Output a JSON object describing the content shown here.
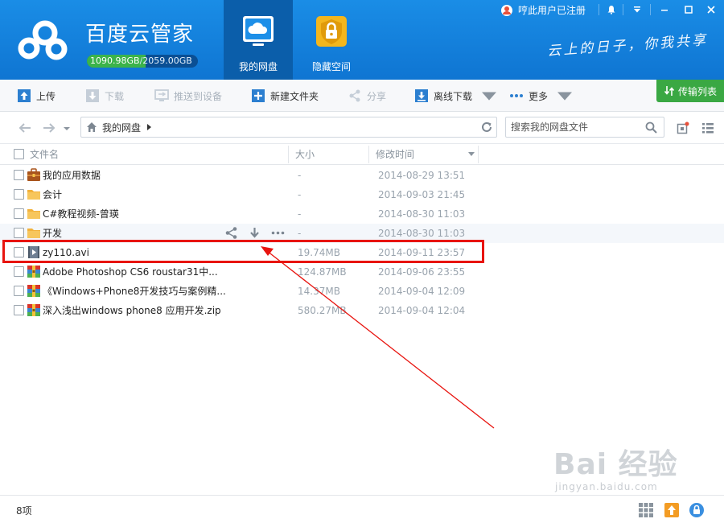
{
  "app": {
    "title": "百度云管家",
    "quota_used": "1090.98GB",
    "quota_separator": "/",
    "quota_total": "2059.00GB",
    "quota_fraction": 0.53,
    "slogan": "云上的日子，你我共享"
  },
  "nav_tabs": [
    {
      "label": "我的网盘",
      "icon": "cloud-disk-icon",
      "active": true
    },
    {
      "label": "隐藏空间",
      "icon": "lock-shield-icon",
      "active": false
    }
  ],
  "topbar": {
    "user_text": "哼此用户已注册",
    "buttons": [
      "bell-icon",
      "menu-down-icon",
      "minimize-icon",
      "maximize-icon",
      "close-icon"
    ]
  },
  "toolbar": {
    "upload": "上传",
    "download": "下载",
    "push_device": "推送到设备",
    "new_folder": "新建文件夹",
    "share": "分享",
    "offline_download": "离线下载",
    "more": "更多",
    "transfer_list": "传输列表"
  },
  "address": {
    "root": "我的网盘",
    "search_placeholder": "搜索我的网盘文件"
  },
  "columns": {
    "name": "文件名",
    "size": "大小",
    "modified": "修改时间"
  },
  "files": [
    {
      "name": "我的应用数据",
      "size": "-",
      "time": "2014-08-29 13:51",
      "type": "app-folder"
    },
    {
      "name": "会计",
      "size": "-",
      "time": "2014-09-03 21:45",
      "type": "folder"
    },
    {
      "name": "C#教程视频-曾瑛",
      "size": "-",
      "time": "2014-08-30 11:03",
      "type": "folder"
    },
    {
      "name": "开发",
      "size": "-",
      "time": "2014-08-30 11:03",
      "type": "folder"
    },
    {
      "name": "zy110.avi",
      "size": "19.74MB",
      "time": "2014-09-11 23:57",
      "type": "video"
    },
    {
      "name": "Adobe Photoshop CS6  roustar31中...",
      "size": "124.87MB",
      "time": "2014-09-06 23:55",
      "type": "archive"
    },
    {
      "name": "《Windows+Phone8开发技巧与案例精...",
      "size": "14.37MB",
      "time": "2014-09-04 12:09",
      "type": "archive"
    },
    {
      "name": "深入浅出windows phone8 应用开发.zip",
      "size": "580.27MB",
      "time": "2014-09-04 12:04",
      "type": "archive"
    }
  ],
  "status": {
    "item_count": "8项"
  },
  "watermark": {
    "main": "Bai 经验",
    "sub": "jingyan.baidu.com"
  },
  "colors": {
    "header_blue": "#1a8de6",
    "active_tab": "#0b5eaa",
    "transfer_green": "#3aa843",
    "annotation_red": "#e8140f"
  }
}
